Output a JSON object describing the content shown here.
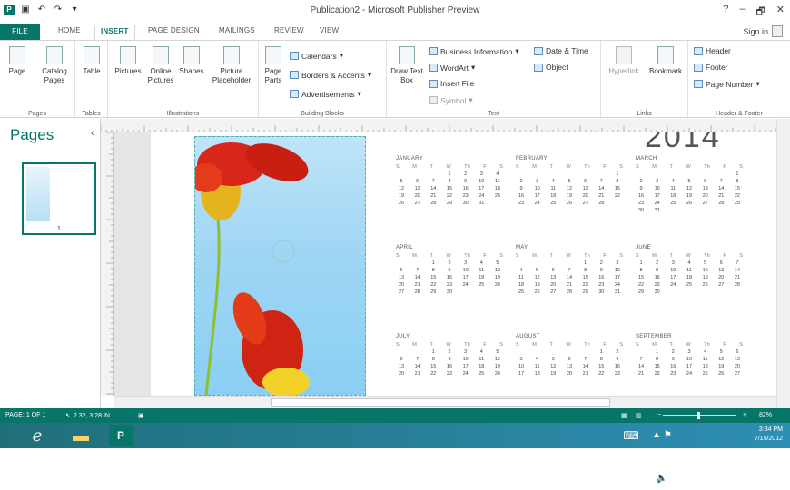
{
  "title": "Publication2 - Microsoft Publisher Preview",
  "window_controls": [
    "?",
    "–",
    "🗗",
    "✕"
  ],
  "tabs": [
    {
      "label": "FILE"
    },
    {
      "label": "HOME"
    },
    {
      "label": "INSERT"
    },
    {
      "label": "PAGE DESIGN"
    },
    {
      "label": "MAILINGS"
    },
    {
      "label": "REVIEW"
    },
    {
      "label": "VIEW"
    }
  ],
  "signin": "Sign in",
  "ribbon": {
    "pages": {
      "label": "Pages",
      "page": "Page",
      "catalog": "Catalog Pages"
    },
    "tables": {
      "label": "Tables",
      "table": "Table"
    },
    "illustrations": {
      "label": "Illustrations",
      "pictures": "Pictures",
      "online_pictures": "Online Pictures",
      "shapes": "Shapes",
      "placeholder": "Picture Placeholder"
    },
    "building_blocks": {
      "label": "Building Blocks",
      "page_parts": "Page Parts",
      "calendars": "Calendars",
      "borders": "Borders & Accents",
      "ads": "Advertisements"
    },
    "text": {
      "label": "Text",
      "draw_text_box": "Draw Text Box",
      "business_info": "Business Information",
      "wordart": "WordArt",
      "insert_file": "Insert File",
      "symbol": "Symbol",
      "date_time": "Date & Time",
      "object": "Object"
    },
    "links": {
      "label": "Links",
      "hyperlink": "Hyperlink",
      "bookmark": "Bookmark"
    },
    "header_footer": {
      "label": "Header & Footer",
      "header": "Header",
      "footer": "Footer",
      "page_number": "Page Number"
    }
  },
  "pages_panel": {
    "title": "Pages",
    "thumb_number": "1"
  },
  "calendar": {
    "year": "2014",
    "day_headers": [
      "S",
      "M",
      "T",
      "W",
      "Th",
      "F",
      "S"
    ],
    "months": [
      {
        "name": "JANUARY",
        "weeks": [
          [
            "",
            "",
            "",
            "1",
            "2",
            "3",
            "4"
          ],
          [
            "5",
            "6",
            "7",
            "8",
            "9",
            "10",
            "11"
          ],
          [
            "12",
            "13",
            "14",
            "15",
            "16",
            "17",
            "18"
          ],
          [
            "19",
            "20",
            "21",
            "22",
            "23",
            "24",
            "25"
          ],
          [
            "26",
            "27",
            "28",
            "29",
            "30",
            "31",
            ""
          ]
        ]
      },
      {
        "name": "FEBRUARY",
        "weeks": [
          [
            "",
            "",
            "",
            "",
            "",
            "",
            "1"
          ],
          [
            "2",
            "3",
            "4",
            "5",
            "6",
            "7",
            "8"
          ],
          [
            "9",
            "10",
            "11",
            "12",
            "13",
            "14",
            "15"
          ],
          [
            "16",
            "17",
            "18",
            "19",
            "20",
            "21",
            "22"
          ],
          [
            "23",
            "24",
            "25",
            "26",
            "27",
            "28",
            ""
          ]
        ]
      },
      {
        "name": "MARCH",
        "weeks": [
          [
            "",
            "",
            "",
            "",
            "",
            "",
            "1"
          ],
          [
            "2",
            "3",
            "4",
            "5",
            "6",
            "7",
            "8"
          ],
          [
            "9",
            "10",
            "11",
            "12",
            "13",
            "14",
            "15"
          ],
          [
            "16",
            "17",
            "18",
            "19",
            "20",
            "21",
            "22"
          ],
          [
            "23",
            "24",
            "25",
            "26",
            "27",
            "28",
            "29"
          ],
          [
            "30",
            "31",
            "",
            "",
            "",
            "",
            ""
          ]
        ]
      },
      {
        "name": "APRIL",
        "weeks": [
          [
            "",
            "",
            "1",
            "2",
            "3",
            "4",
            "5"
          ],
          [
            "6",
            "7",
            "8",
            "9",
            "10",
            "11",
            "12"
          ],
          [
            "13",
            "14",
            "15",
            "16",
            "17",
            "18",
            "19"
          ],
          [
            "20",
            "21",
            "22",
            "23",
            "24",
            "25",
            "26"
          ],
          [
            "27",
            "28",
            "29",
            "30",
            "",
            "",
            ""
          ]
        ]
      },
      {
        "name": "MAY",
        "weeks": [
          [
            "",
            "",
            "",
            "",
            "1",
            "2",
            "3"
          ],
          [
            "4",
            "5",
            "6",
            "7",
            "8",
            "9",
            "10"
          ],
          [
            "11",
            "12",
            "13",
            "14",
            "15",
            "16",
            "17"
          ],
          [
            "18",
            "19",
            "20",
            "21",
            "22",
            "23",
            "24"
          ],
          [
            "25",
            "26",
            "27",
            "28",
            "29",
            "30",
            "31"
          ]
        ]
      },
      {
        "name": "JUNE",
        "weeks": [
          [
            "1",
            "2",
            "3",
            "4",
            "5",
            "6",
            "7"
          ],
          [
            "8",
            "9",
            "10",
            "11",
            "12",
            "13",
            "14"
          ],
          [
            "15",
            "16",
            "17",
            "18",
            "19",
            "20",
            "21"
          ],
          [
            "22",
            "23",
            "24",
            "25",
            "26",
            "27",
            "28"
          ],
          [
            "29",
            "30",
            "",
            "",
            "",
            "",
            ""
          ]
        ]
      },
      {
        "name": "JULY",
        "weeks": [
          [
            "",
            "",
            "1",
            "2",
            "3",
            "4",
            "5"
          ],
          [
            "6",
            "7",
            "8",
            "9",
            "10",
            "11",
            "12"
          ],
          [
            "13",
            "14",
            "15",
            "16",
            "17",
            "18",
            "19"
          ],
          [
            "20",
            "21",
            "22",
            "23",
            "24",
            "25",
            "26"
          ]
        ]
      },
      {
        "name": "AUGUST",
        "weeks": [
          [
            "",
            "",
            "",
            "",
            "",
            "1",
            "2"
          ],
          [
            "3",
            "4",
            "5",
            "6",
            "7",
            "8",
            "9"
          ],
          [
            "10",
            "11",
            "12",
            "13",
            "14",
            "15",
            "16"
          ],
          [
            "17",
            "18",
            "19",
            "20",
            "21",
            "22",
            "23"
          ]
        ]
      },
      {
        "name": "SEPTEMBER",
        "weeks": [
          [
            "",
            "1",
            "2",
            "3",
            "4",
            "5",
            "6"
          ],
          [
            "7",
            "8",
            "9",
            "10",
            "11",
            "12",
            "13"
          ],
          [
            "14",
            "15",
            "16",
            "17",
            "18",
            "19",
            "20"
          ],
          [
            "21",
            "22",
            "23",
            "24",
            "25",
            "26",
            "27"
          ]
        ]
      }
    ]
  },
  "status": {
    "page": "PAGE: 1 OF 1",
    "position": "2.32, 3.28 IN.",
    "zoom": "82%"
  },
  "taskbar": {
    "time": "3:34 PM",
    "date": "7/15/2012"
  },
  "colors": {
    "accent": "#077568",
    "taskbar": "#2e8fb4"
  }
}
